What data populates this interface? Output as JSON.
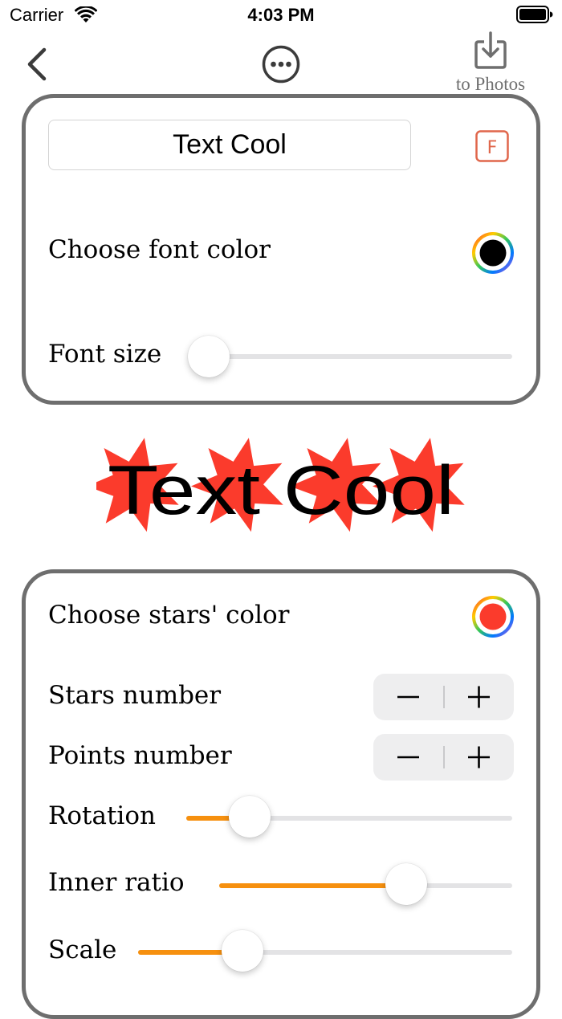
{
  "status_bar": {
    "carrier": "Carrier",
    "time": "4:03 PM",
    "wifi_icon": "wifi-icon",
    "battery_icon": "battery-icon"
  },
  "nav": {
    "back_icon": "chevron-left-icon",
    "more_icon": "ellipsis-circle-icon",
    "save_icon": "tray-download-icon",
    "save_label": "to Photos"
  },
  "text_settings": {
    "text_value": "Text Cool",
    "font_button_letter": "F",
    "font_color_label": "Choose font color",
    "font_color": "#000000",
    "font_size_label": "Font size",
    "font_size_level": 0.0
  },
  "preview": {
    "text": "Text Cool",
    "star_color": "#fb3b2c",
    "text_color": "#000000",
    "stars_count": 4,
    "points_count": 7
  },
  "star_settings": {
    "stars_color_label": "Choose stars' color",
    "stars_color": "#fb3b2c",
    "stars_number_label": "Stars number",
    "points_number_label": "Points number",
    "minus_symbol": "−",
    "plus_symbol": "+",
    "rotation_label": "Rotation",
    "rotation_level": 0.15,
    "inner_ratio_label": "Inner ratio",
    "inner_ratio_level": 0.66,
    "scale_label": "Scale",
    "scale_level": 0.25
  },
  "colors": {
    "accent": "#f6900f",
    "panel_border": "#6e6e6e",
    "font_button": "#e0674c"
  }
}
